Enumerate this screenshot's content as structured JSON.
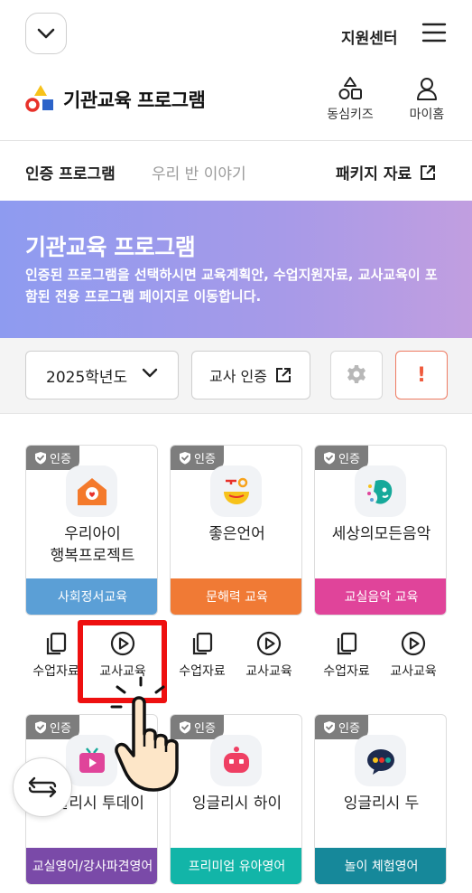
{
  "header": {
    "support_label": "지원센터",
    "brand_title": "기관교육 프로그램",
    "dongsim_label": "동심키즈",
    "mypage_label": "마이홈"
  },
  "tabs": {
    "certified": "인증 프로그램",
    "our_class": "우리 반 이야기",
    "package": "패키지 자료"
  },
  "hero": {
    "title": "기관교육 프로그램",
    "desc": "인증된 프로그램을 선택하시면 교육계획안, 수업지원자료, 교사교육이 포함된 전용 프로그램 페이지로 이동합니다."
  },
  "filters": {
    "year": "2025학년도",
    "teacher_cert": "교사 인증",
    "alert": "!"
  },
  "badge_label": "인증",
  "programs": [
    {
      "name_line1": "우리아이",
      "name_line2": "행복프로젝트",
      "category": "사회정서교육",
      "color": "#5b9fd6",
      "icon": "house-heart-icon"
    },
    {
      "name_line1": "좋은언어",
      "name_line2": "",
      "category": "문해력 교육",
      "color": "#f07a35",
      "icon": "language-bowl-icon"
    },
    {
      "name_line1": "세상의모든음악",
      "name_line2": "",
      "category": "교실음악 교육",
      "color": "#e0449a",
      "icon": "music-face-icon"
    },
    {
      "name_line1": "잉글리시 투데이",
      "name_line2": "",
      "category": "교실영어/강사파견영어",
      "color": "#7a4aa8",
      "icon": "tv-play-icon"
    },
    {
      "name_line1": "잉글리시 하이",
      "name_line2": "",
      "category": "프리미엄 유아영어",
      "color": "#12b5a8",
      "icon": "chat-robot-icon"
    },
    {
      "name_line1": "잉글리시 두",
      "name_line2": "",
      "category": "놀이 체험영어",
      "color": "#16889a",
      "icon": "speech-bubble-icon"
    }
  ],
  "actions": {
    "materials": "수업자료",
    "teacher_edu": "교사교육"
  }
}
